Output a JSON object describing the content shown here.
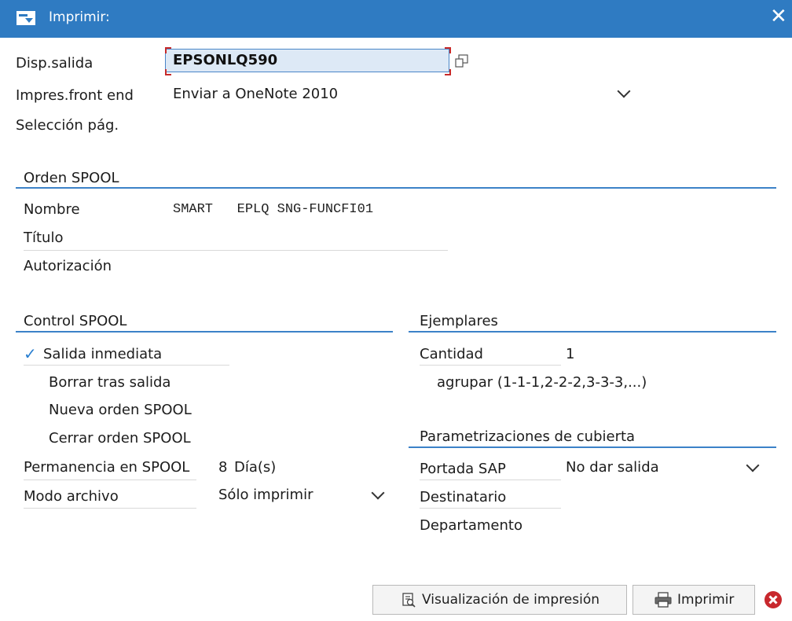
{
  "window": {
    "title": "Imprimir:"
  },
  "output": {
    "device_label": "Disp.salida",
    "device_value": "EPSONLQ590",
    "frontend_label": "Impres.front end",
    "frontend_value": "Enviar a OneNote 2010",
    "page_selection_label": "Selección pág."
  },
  "spool_request": {
    "heading": "Orden SPOOL",
    "name_label": "Nombre",
    "name_value": "SMART   EPLQ SNG-FUNCFI01",
    "title_label": "Título",
    "authorization_label": "Autorización"
  },
  "spool_control": {
    "heading": "Control SPOOL",
    "immediate_output": "Salida inmediata",
    "delete_after_output": "Borrar tras salida",
    "new_spool_request": "Nueva orden SPOOL",
    "close_spool_request": "Cerrar orden SPOOL",
    "retention_label": "Permanencia en SPOOL",
    "retention_value": "8",
    "retention_unit": "Día(s)",
    "archive_mode_label": "Modo archivo",
    "archive_mode_value": "Sólo imprimir"
  },
  "copies": {
    "heading": "Ejemplares",
    "quantity_label": "Cantidad",
    "quantity_value": "1",
    "group_label": "agrupar (1-1-1,2-2-2,3-3-3,...)"
  },
  "cover_settings": {
    "heading": "Parametrizaciones de cubierta",
    "sap_cover_label": "Portada SAP",
    "sap_cover_value": "No dar salida",
    "recipient_label": "Destinatario",
    "department_label": "Departamento"
  },
  "buttons": {
    "preview": "Visualización de impresión",
    "print": "Imprimir"
  },
  "colors": {
    "titlebar": "#2f7bc2",
    "accent_line": "#3c82c8",
    "input_bg": "#dde9f6",
    "cancel": "#c8282d"
  }
}
